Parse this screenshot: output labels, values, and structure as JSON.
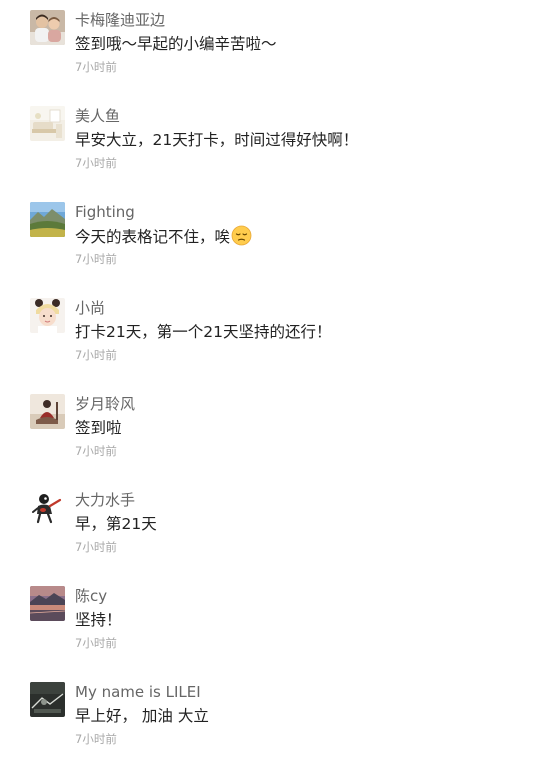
{
  "comments": [
    {
      "username": "卡梅隆迪亚边",
      "text": "签到哦～早起的小编辛苦啦～",
      "time": "7小时前",
      "avatar_icon": "family-photo-avatar"
    },
    {
      "username": "美人鱼",
      "text": "早安大立，21天打卡，时间过得好快啊！",
      "time": "7小时前",
      "avatar_icon": "room-photo-avatar"
    },
    {
      "username": "Fighting",
      "text": "今天的表格记不住，唉",
      "time": "7小时前",
      "avatar_icon": "landscape-photo-avatar",
      "emoji": "pensive-face-icon"
    },
    {
      "username": "小尚",
      "text": "打卡21天，第一个21天坚持的还行！",
      "time": "7小时前",
      "avatar_icon": "girl-photo-avatar"
    },
    {
      "username": "岁月聆风",
      "text": "签到啦",
      "time": "7小时前",
      "avatar_icon": "figure-photo-avatar"
    },
    {
      "username": "大力水手",
      "text": "早，第21天",
      "time": "7小时前",
      "avatar_icon": "cartoon-sailor-avatar"
    },
    {
      "username": "陈cy",
      "text": "坚持！",
      "time": "7小时前",
      "avatar_icon": "sunset-lake-avatar"
    },
    {
      "username": "My name is LILEI",
      "text": "早上好， 加油 大立",
      "time": "7小时前",
      "avatar_icon": "dark-scene-avatar"
    }
  ]
}
